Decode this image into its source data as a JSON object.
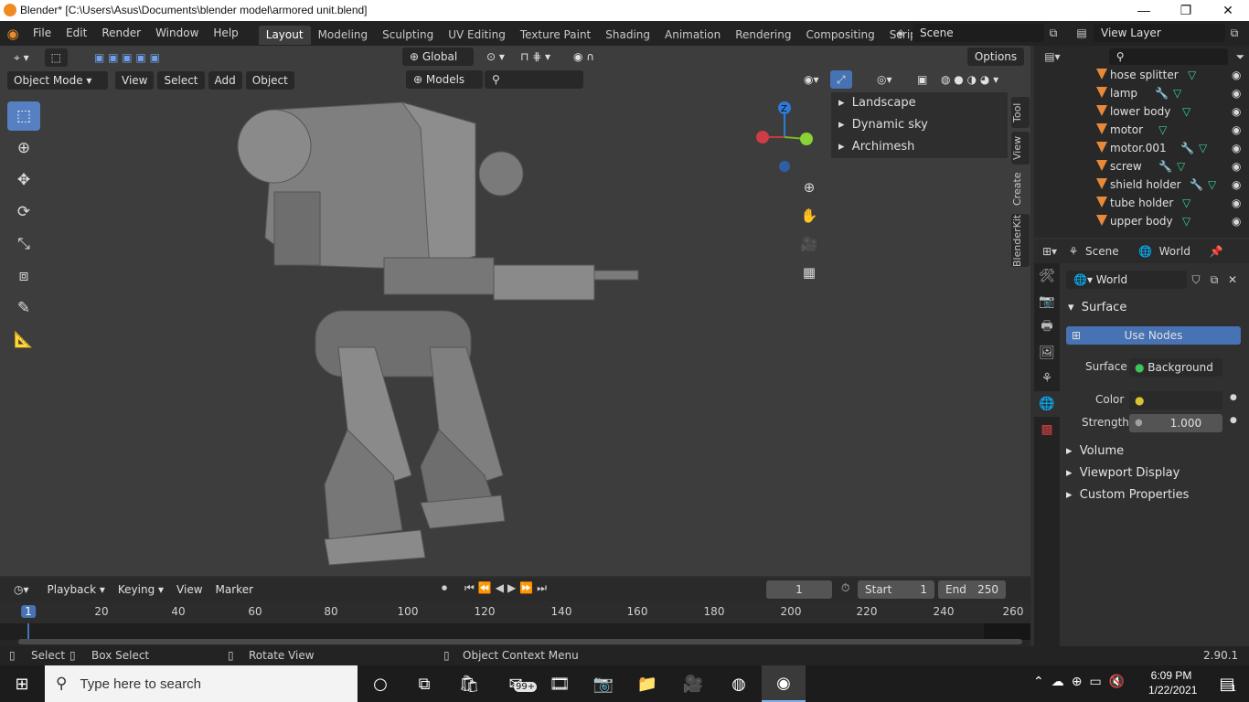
{
  "window": {
    "title": "Blender* [C:\\Users\\Asus\\Documents\\blender model\\armored unit.blend]",
    "minimize": "—",
    "maximize": "❐",
    "close": "✕"
  },
  "menu": [
    "File",
    "Edit",
    "Render",
    "Window",
    "Help"
  ],
  "workspaces": [
    "Layout",
    "Modeling",
    "Sculpting",
    "UV Editing",
    "Texture Paint",
    "Shading",
    "Animation",
    "Rendering",
    "Compositing",
    "Scripting"
  ],
  "scene": {
    "name": "Scene",
    "view_layer": "View Layer"
  },
  "viewport": {
    "orientation": "Global",
    "options_label": "Options",
    "mode": "Object Mode",
    "header_menus": [
      "View",
      "Select",
      "Add",
      "Object"
    ],
    "collection_filter": "Models",
    "gizmo_axis": "Z"
  },
  "npanel": {
    "items": [
      "Landscape",
      "Dynamic sky",
      "Archimesh"
    ],
    "tabs": [
      "Tool",
      "View",
      "Create",
      "BlenderKit"
    ]
  },
  "outliner": {
    "rows": [
      {
        "name": "hose splitter",
        "icons": [
          "mesh"
        ]
      },
      {
        "name": "lamp",
        "icons": [
          "modifier",
          "mesh"
        ]
      },
      {
        "name": "lower body",
        "icons": [
          "mesh"
        ]
      },
      {
        "name": "motor",
        "icons": [
          "mesh"
        ]
      },
      {
        "name": "motor.001",
        "icons": [
          "modifier",
          "mesh"
        ]
      },
      {
        "name": "screw",
        "icons": [
          "modifier",
          "mesh"
        ]
      },
      {
        "name": "shield holder",
        "icons": [
          "modifier",
          "mesh"
        ]
      },
      {
        "name": "tube holder",
        "icons": [
          "mesh"
        ]
      },
      {
        "name": "upper body",
        "icons": [
          "mesh"
        ]
      }
    ]
  },
  "properties": {
    "breadcrumb_scene": "Scene",
    "breadcrumb_world": "World",
    "world_name": "World",
    "surface_panel": "Surface",
    "use_nodes": "Use Nodes",
    "surface_label": "Surface",
    "surface_value": "Background",
    "color_label": "Color",
    "strength_label": "Strength",
    "strength_value": "1.000",
    "collapsed_panels": [
      "Volume",
      "Viewport Display",
      "Custom Properties"
    ]
  },
  "timeline": {
    "menus": [
      "Playback",
      "Keying",
      "View",
      "Marker"
    ],
    "current_frame": "1",
    "start_label": "Start",
    "start_value": "1",
    "end_label": "End",
    "end_value": "250",
    "ticks": [
      "1",
      "20",
      "40",
      "60",
      "80",
      "100",
      "120",
      "140",
      "160",
      "180",
      "200",
      "220",
      "240",
      "260"
    ]
  },
  "statusbar": {
    "select": "Select",
    "box_select": "Box Select",
    "rotate": "Rotate View",
    "context": "Object Context Menu",
    "version": "2.90.1"
  },
  "taskbar": {
    "search_placeholder": "Type here to search",
    "mail_badge": "99+",
    "time": "6:09 PM",
    "date": "1/22/2021",
    "notification_count": "1"
  }
}
